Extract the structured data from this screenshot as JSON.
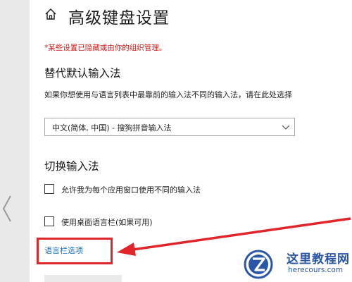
{
  "header": {
    "title": "高级键盘设置",
    "home_icon": "home-icon"
  },
  "notice": {
    "text": "*某些设置已隐藏或由你的组织管理。",
    "color": "#d01818"
  },
  "override_input": {
    "section_title": "替代默认输入法",
    "description": "如果你想使用与语言列表中最靠前的输入法不同的输入法，请在此处选择",
    "selected_value": "中文(简体, 中国) - 搜狗拼音输入法",
    "chevron_icon": "chevron-down-icon"
  },
  "switch_input": {
    "section_title": "切换输入法",
    "options": [
      {
        "label": "允许我为每个应用窗口使用不同的输入法",
        "checked": false
      },
      {
        "label": "使用桌面语言栏(如果可用)",
        "checked": false
      }
    ]
  },
  "language_bar_link": {
    "label": "语言栏选项",
    "color": "#1a6fc4"
  },
  "annotation": {
    "highlight_color": "#e0252b",
    "arrow_color": "#e0252b"
  },
  "watermark": {
    "name": "这里教程网",
    "url": "herecours.com",
    "color": "#2a56a8"
  }
}
